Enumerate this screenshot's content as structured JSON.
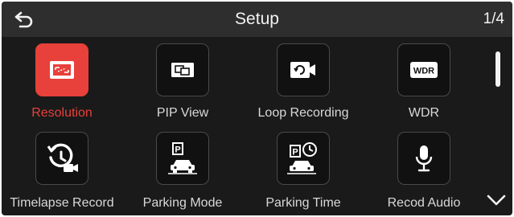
{
  "header": {
    "title": "Setup",
    "page_indicator": "1/4",
    "back_icon": "back-arrow-icon"
  },
  "menu": {
    "items": [
      {
        "label": "Resolution",
        "icon": "resolution-icon",
        "selected": true
      },
      {
        "label": "PIP View",
        "icon": "pip-view-icon",
        "selected": false
      },
      {
        "label": "Loop Recording",
        "icon": "loop-recording-icon",
        "selected": false
      },
      {
        "label": "WDR",
        "icon": "wdr-icon",
        "icon_text": "WDR",
        "selected": false
      },
      {
        "label": "Timelapse Record",
        "icon": "timelapse-icon",
        "selected": false
      },
      {
        "label": "Parking Mode",
        "icon": "parking-mode-icon",
        "icon_text": "P",
        "selected": false
      },
      {
        "label": "Parking Time",
        "icon": "parking-time-icon",
        "icon_text": "P",
        "selected": false
      },
      {
        "label": "Recod Audio",
        "icon": "microphone-icon",
        "selected": false
      }
    ]
  },
  "footer": {
    "down_icon": "chevron-down-icon"
  },
  "colors": {
    "accent": "#e8403a",
    "background": "#1a1a1a",
    "topbar": "#2e2e2e",
    "text": "#d9d9d9"
  }
}
